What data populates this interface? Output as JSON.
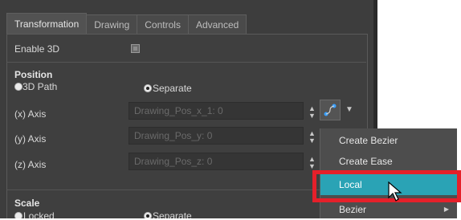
{
  "tabs": [
    {
      "label": "Transformation",
      "active": true
    },
    {
      "label": "Drawing",
      "active": false
    },
    {
      "label": "Controls",
      "active": false
    },
    {
      "label": "Advanced",
      "active": false
    }
  ],
  "enable_3d": {
    "label": "Enable 3D",
    "checked": false
  },
  "position": {
    "heading": "Position",
    "opt_3d_path": {
      "label": "3D Path",
      "selected": false
    },
    "opt_separate": {
      "label": "Separate",
      "selected": true
    },
    "axes": [
      {
        "label": "(x) Axis",
        "value": "Drawing_Pos_x_1: 0"
      },
      {
        "label": "(y) Axis",
        "value": "Drawing_Pos_y: 0"
      },
      {
        "label": "(z) Axis",
        "value": "Drawing_Pos_z: 0"
      }
    ]
  },
  "scale": {
    "heading": "Scale",
    "opt_locked": {
      "label": "Locked",
      "selected": false
    },
    "opt_separate": {
      "label": "Separate",
      "selected": true
    }
  },
  "context_menu": {
    "items": [
      {
        "label": "Create Bezier",
        "highlighted": false
      },
      {
        "label": "Create Ease",
        "highlighted": false
      },
      {
        "label": "Local",
        "highlighted": true
      },
      {
        "label": "Bezier",
        "highlighted": false,
        "submenu": true
      }
    ]
  },
  "colors": {
    "panel_bg": "#3d3d3d",
    "menu_highlight": "#2aa3b5",
    "annotation_red": "#e5202a",
    "function_icon": "#3aa0ff"
  },
  "icons": {
    "function_button": "function-curve-icon",
    "dropdown": "chevron-down-icon",
    "cursor": "mouse-pointer-icon"
  }
}
